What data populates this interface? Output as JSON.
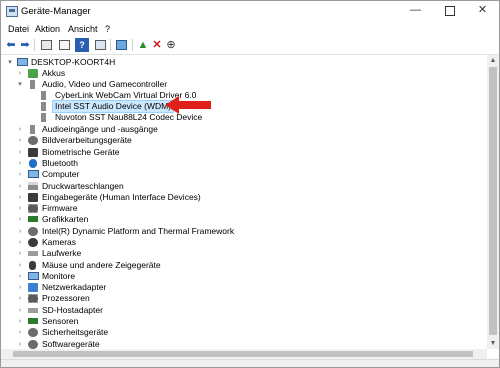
{
  "window": {
    "title": "Geräte-Manager"
  },
  "menu": [
    "Datei",
    "Aktion",
    "Ansicht",
    "?"
  ],
  "toolbar_icons": [
    "back-arrow-icon",
    "forward-arrow-icon",
    "properties-icon",
    "device-list-icon",
    "help-icon",
    "resources-icon",
    "scan-hardware-icon",
    "update-driver-icon",
    "uninstall-icon",
    "disable-icon"
  ],
  "tree": {
    "root": "DESKTOP-KOORT4H",
    "audio_children": [
      "CyberLink WebCam Virtual Driver 6.0",
      "Intel SST Audio Device (WDM)",
      "Nuvoton SST Nau88L24 Codec Device"
    ],
    "categories": [
      "Akkus",
      "Audio, Video und Gamecontroller",
      "Audioeingänge und -ausgänge",
      "Bildverarbeitungsgeräte",
      "Biometrische Geräte",
      "Bluetooth",
      "Computer",
      "Druckwarteschlangen",
      "Eingabegeräte (Human Interface Devices)",
      "Firmware",
      "Grafikkarten",
      "Intel(R) Dynamic Platform and Thermal Framework",
      "Kameras",
      "Laufwerke",
      "Mäuse und andere Zeigegeräte",
      "Monitore",
      "Netzwerkadapter",
      "Prozessoren",
      "SD-Hostadapter",
      "Sensoren",
      "Sicherheitsgeräte",
      "Softwaregeräte"
    ],
    "selected": "Intel SST Audio Device (WDM)"
  },
  "colors": {
    "arrow": "#e0201b",
    "selection": "#cce8ff"
  }
}
